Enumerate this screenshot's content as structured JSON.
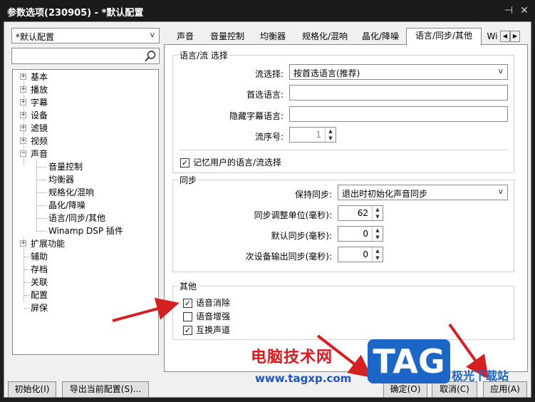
{
  "window": {
    "title": "参数选项(230905) - *默认配置",
    "pin_glyph": "⊣",
    "close_glyph": "✕"
  },
  "profile": {
    "value": "*默认配置"
  },
  "search": {
    "icon": "search-icon"
  },
  "tree": {
    "items": [
      {
        "label": "基本",
        "expander": "+"
      },
      {
        "label": "播放",
        "expander": "+"
      },
      {
        "label": "字幕",
        "expander": "+"
      },
      {
        "label": "设备",
        "expander": "+"
      },
      {
        "label": "滤镜",
        "expander": "+"
      },
      {
        "label": "视频",
        "expander": "+"
      },
      {
        "label": "声音",
        "expander": "−"
      },
      {
        "label": "音量控制"
      },
      {
        "label": "均衡器"
      },
      {
        "label": "规格化/混响"
      },
      {
        "label": "晶化/降噪"
      },
      {
        "label": "语言/同步/其他"
      },
      {
        "label": "Winamp DSP 插件"
      },
      {
        "label": "扩展功能",
        "expander": "+"
      },
      {
        "label": "辅助"
      },
      {
        "label": "存档"
      },
      {
        "label": "关联"
      },
      {
        "label": "配置"
      },
      {
        "label": "屏保"
      }
    ]
  },
  "tabs": {
    "items": [
      "声音",
      "音量控制",
      "均衡器",
      "规格化/混响",
      "晶化/降噪",
      "语言/同步/其他",
      "Wi"
    ],
    "active_index": 5,
    "scroll_left": "◀",
    "scroll_right": "▶"
  },
  "lang_group": {
    "legend": "语言/流 选择",
    "stream_select_label": "流选择:",
    "stream_select_value": "按首选语言(推荐)",
    "preferred_lang_label": "首选语言:",
    "preferred_lang_value": "",
    "hidden_sub_label": "隐藏字幕语言:",
    "hidden_sub_value": "",
    "stream_no_label": "流序号:",
    "stream_no_value": "1",
    "remember_label": "记忆用户的语言/流选择",
    "remember_checked": true
  },
  "sync_group": {
    "legend": "同步",
    "keep_sync_label": "保持同步:",
    "keep_sync_value": "退出时初始化声音同步",
    "adjust_unit_label": "同步调整单位(毫秒):",
    "adjust_unit_value": "62",
    "default_sync_label": "默认同步(毫秒):",
    "default_sync_value": "0",
    "secondary_sync_label": "次设备输出同步(毫秒):",
    "secondary_sync_value": "0"
  },
  "other_group": {
    "legend": "其他",
    "items": [
      {
        "label": "语音消除",
        "checked": true
      },
      {
        "label": "语音增强",
        "checked": false
      },
      {
        "label": "互换声道",
        "checked": true
      }
    ]
  },
  "footer": {
    "init_button": "初始化(I)",
    "export_button": "导出当前配置(S)...",
    "ok_button": "确定(O)",
    "cancel_button": "取消(C)",
    "apply_button": "应用(A)"
  },
  "watermark": {
    "site_name": "电脑技术网",
    "url": "www.tagxp.com",
    "logo_text": "TAG",
    "brand_text": "极光下载站"
  },
  "colors": {
    "annotation_arrow": "#d42020",
    "logo_blue": "#1b66c6"
  }
}
